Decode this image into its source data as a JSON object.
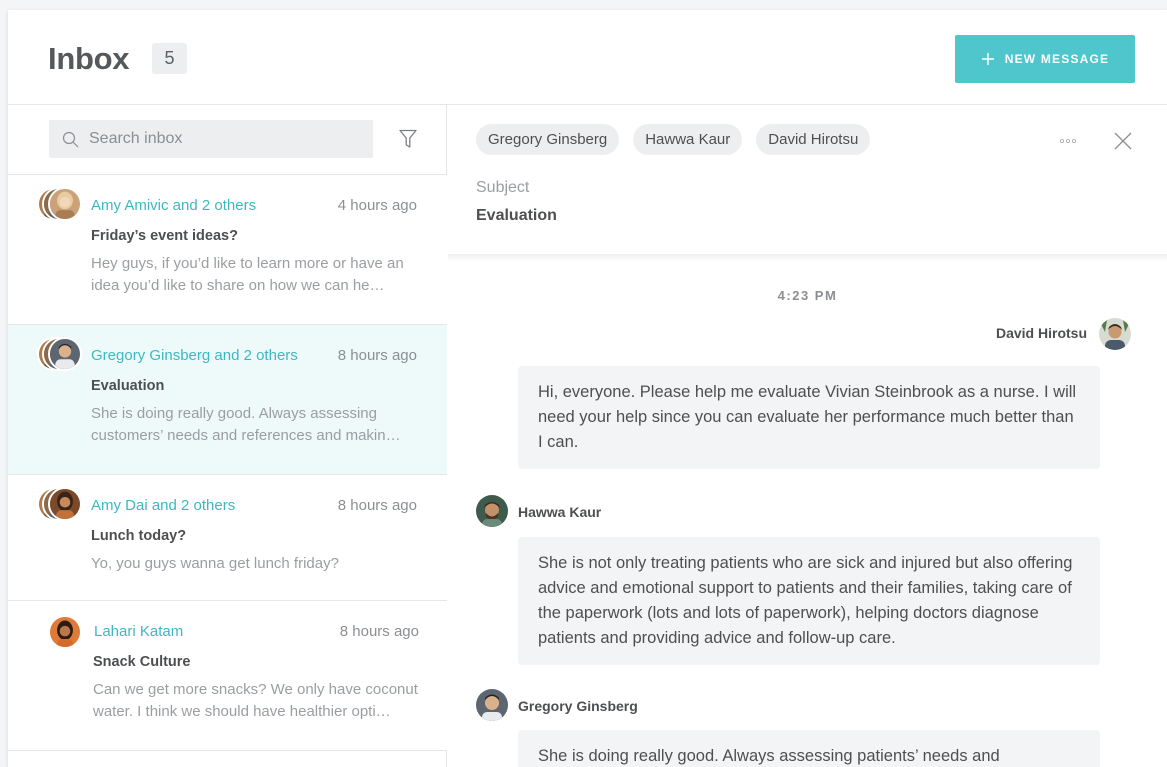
{
  "header": {
    "title": "Inbox",
    "count": "5",
    "new_message_label": "NEW MESSAGE"
  },
  "sidebar": {
    "search_placeholder": "Search inbox",
    "conversations": [
      {
        "name": "Amy Amivic and 2 others",
        "time": "4 hours ago",
        "subject": "Friday’s event ideas?",
        "preview": "Hey guys, if you’d like to learn more or have an idea  you’d like to share on how we can he…",
        "selected": false
      },
      {
        "name": "Gregory Ginsberg and 2 others",
        "time": "8 hours ago",
        "subject": "Evaluation",
        "preview": "She is doing really good. Always assessing customers’ needs and references and makin…",
        "selected": true
      },
      {
        "name": "Amy Dai and 2 others",
        "time": "8 hours ago",
        "subject": "Lunch today?",
        "preview": "Yo, you guys wanna get lunch friday?",
        "selected": false
      },
      {
        "name": "Lahari Katam",
        "time": "8 hours ago",
        "subject": "Snack Culture",
        "preview": "Can we get more snacks? We only have coconut water. I think we should have healthier opti…",
        "selected": false
      }
    ]
  },
  "main": {
    "recipients": [
      "Gregory Ginsberg",
      "Hawwa Kaur",
      "David Hirotsu"
    ],
    "subject_label": "Subject",
    "subject_value": "Evaluation",
    "timestamp": "4:23 PM",
    "messages": [
      {
        "author": "David Hirotsu",
        "text": "Hi, everyone. Please help me evaluate Vivian Steinbrook as a nurse. I will need your help since you can evaluate her performance much better than I can."
      },
      {
        "author": "Hawwa Kaur",
        "text": "She is not only treating patients who are sick and injured but also offering advice and emotional support to patients and their families, taking care of the paperwork (lots and lots of paperwork), helping doctors diagnose patients and providing advice and follow-up care."
      },
      {
        "author": "Gregory Ginsberg",
        "text": "She is doing really good. Always assessing patients’ needs and"
      }
    ]
  },
  "colors": {
    "accent": "#4ec6cc",
    "link": "#3db8c1",
    "selected_row": "#eefaf9"
  },
  "icons": [
    "plus-icon",
    "search-icon",
    "filter-icon",
    "more-icon",
    "close-icon"
  ]
}
